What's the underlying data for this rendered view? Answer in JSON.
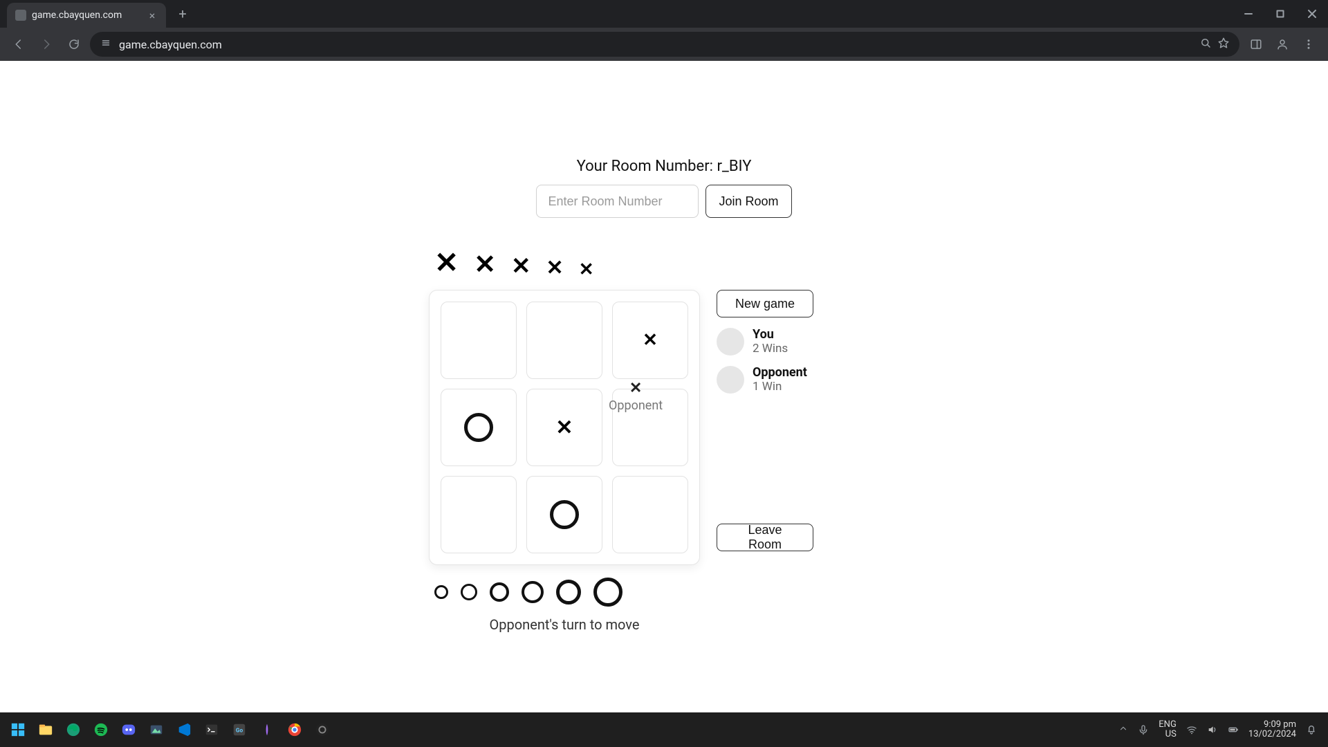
{
  "browser": {
    "tab_title": "game.cbayquen.com",
    "url": "game.cbayquen.com"
  },
  "room": {
    "label_prefix": "Your Room Number: ",
    "number": "r_BIY",
    "input_placeholder": "Enter Room Number",
    "join_label": "Join Room"
  },
  "tokens": {
    "x_count": 5,
    "o_count": 6
  },
  "board": {
    "cells": [
      "",
      "",
      "X",
      "O",
      "X",
      "",
      "",
      "O",
      ""
    ],
    "turn_text": "Opponent's turn to move",
    "float_label": "Opponent"
  },
  "side": {
    "new_game_label": "New game",
    "leave_label": "Leave Room",
    "you": {
      "name": "You",
      "wins": "2 Wins"
    },
    "opponent": {
      "name": "Opponent",
      "wins": "1 Win"
    }
  },
  "taskbar": {
    "lang1": "ENG",
    "lang2": "US",
    "time": "9:09 pm",
    "date": "13/02/2024"
  }
}
